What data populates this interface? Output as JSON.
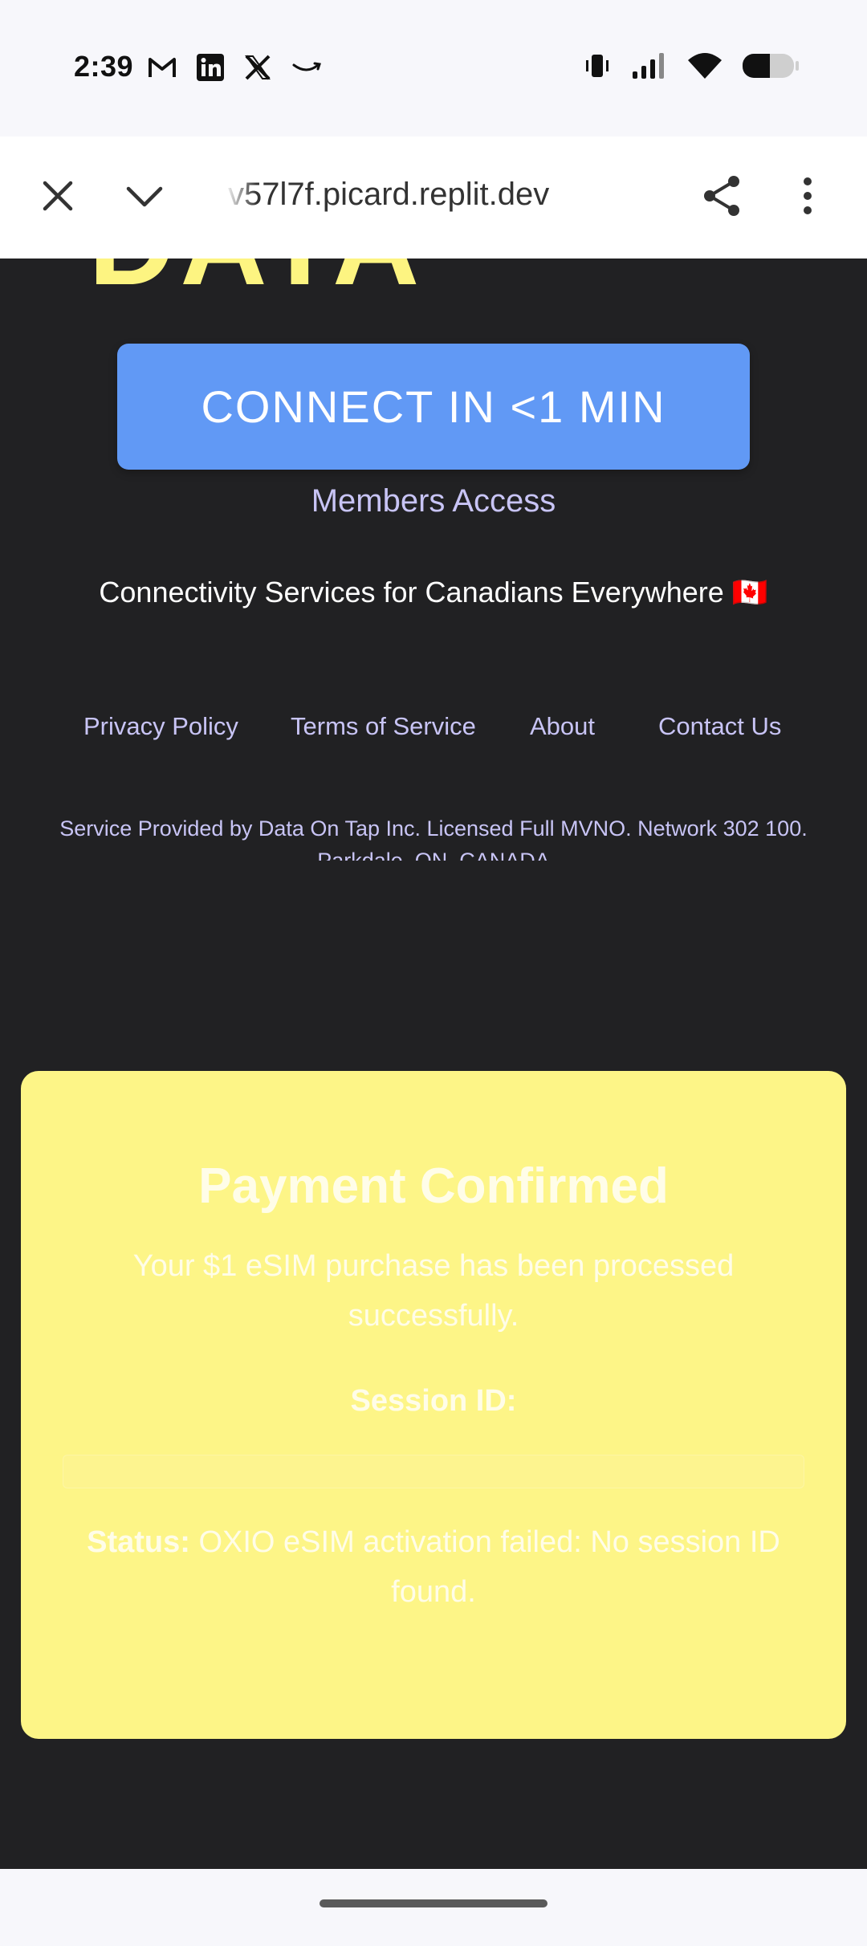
{
  "status_bar": {
    "time": "2:39",
    "notification_icons": [
      "gmail-icon",
      "linkedin-icon",
      "x-icon",
      "amazon-icon"
    ],
    "system_icons": [
      "vibrate-icon",
      "signal-icon",
      "wifi-icon",
      "battery-icon"
    ]
  },
  "browser": {
    "url": "v57l7f.picard.replit.dev",
    "close_icon": "close-icon",
    "collapse_icon": "chevron-down-icon",
    "share_icon": "share-icon",
    "menu_icon": "more-vert-icon"
  },
  "page": {
    "logo_text": "DATA",
    "cta_label": "CONNECT IN <1 MIN",
    "members_link": "Members Access",
    "tagline": "Connectivity Services for Canadians Everywhere 🇨🇦",
    "footer_links": [
      "Privacy Policy",
      "Terms of Service",
      "About",
      "Contact Us"
    ],
    "legal_line1": "Service Provided by Data On Tap Inc. Licensed Full MVNO. Network 302 100.",
    "legal_line2": "Parkdale, ON, CANADA"
  },
  "confirmation": {
    "title": "Payment Confirmed",
    "message": "Your $1 eSIM purchase has been processed successfully.",
    "session_label": "Session ID:",
    "session_value": "",
    "status_label": "Status:",
    "status_text": " OXIO eSIM activation failed: No session ID found."
  },
  "colors": {
    "page_bg": "#212123",
    "cta_bg": "#6199f5",
    "link_color": "#c8c4f5",
    "card_bg": "#fdf587",
    "logo_yellow": "#fdf481"
  }
}
